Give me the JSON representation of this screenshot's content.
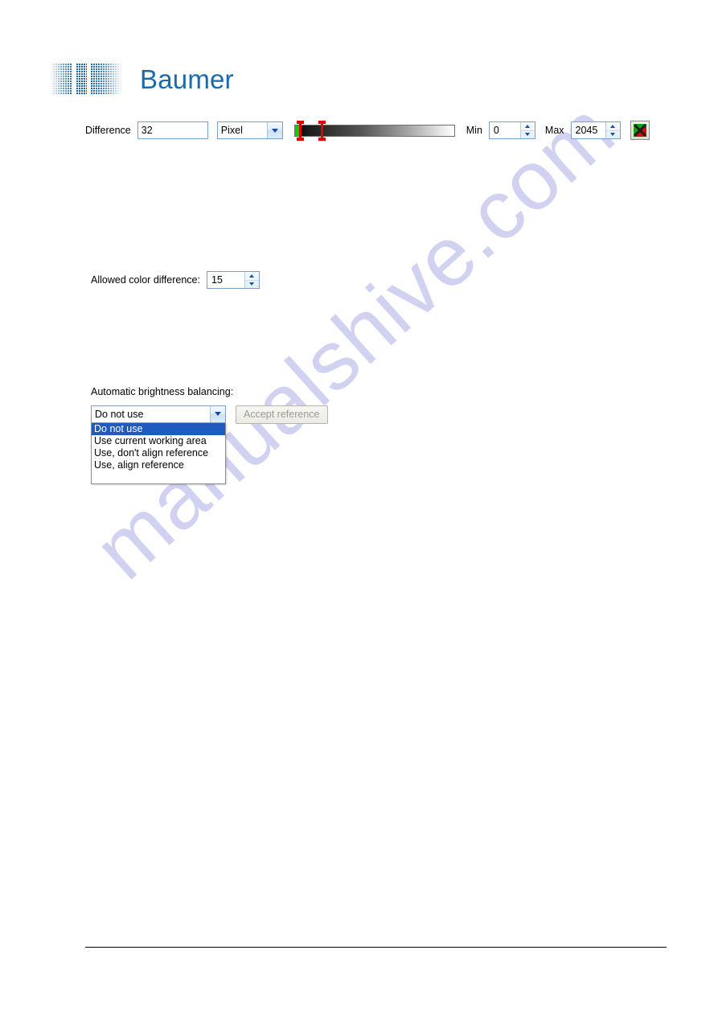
{
  "brand": {
    "wordmark": "Baumer",
    "color": "#1a6aab"
  },
  "watermark": {
    "text": "manualshive.com",
    "color": "#c9c9ef"
  },
  "difference_row": {
    "label": "Difference",
    "value": "32",
    "unit_selected": "Pixel",
    "unit_options": [
      "Pixel"
    ],
    "min_label": "Min",
    "min_value": "0",
    "max_label": "Max",
    "max_value": "2045",
    "reset_icon": "green-red-x-icon",
    "gradient": {
      "from": "#000000",
      "to": "#ffffff",
      "marker_color": "#e00000",
      "lower_block_color": "#00d400"
    }
  },
  "allowed_color_row": {
    "label": "Allowed color difference:",
    "value": "15"
  },
  "brightness_section": {
    "label": "Automatic brightness balancing:",
    "selected": "Do not use",
    "options": [
      "Do not use",
      "Use current working area",
      "Use, don't align reference",
      "Use, align reference"
    ],
    "accept_button_label": "Accept reference",
    "highlight_color": "#1f5bbf"
  }
}
